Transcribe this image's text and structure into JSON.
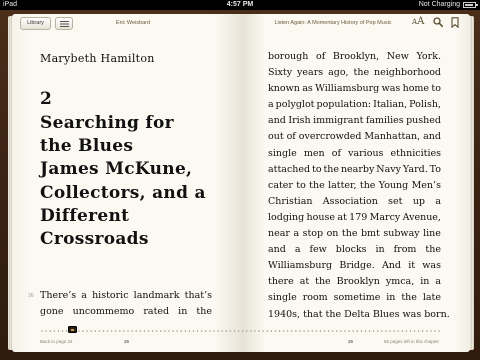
{
  "status_bar": {
    "device": "iPad",
    "time": "4:57 PM",
    "charging": "Not Charging"
  },
  "toolbar": {
    "library_label": "Library",
    "author": "Eric Weisbard",
    "book_title": "Listen Again: A Momentary History of Pop Music",
    "icons": [
      "table-of-contents-icon",
      "font-size-icon",
      "search-icon",
      "bookmark-icon"
    ]
  },
  "left_page": {
    "author_name": "Marybeth Hamilton",
    "chapter_number": "2",
    "chapter_title_lines": [
      "Searching for",
      "the Blues",
      "James McKune,",
      "Collectors, and a",
      "Different",
      "Crossroads"
    ],
    "margin_page": "26",
    "body_lines": [
      [
        "There’s",
        "a",
        "historic",
        "landmark",
        "that’s"
      ],
      [
        "gone",
        "uncommemo",
        "rated",
        "in",
        "the"
      ]
    ]
  },
  "right_page": {
    "body_lines": [
      [
        "borough",
        "of",
        "Brooklyn,",
        "New",
        "York."
      ],
      [
        "Sixty",
        "years",
        "ago,",
        "the",
        "neighborhood"
      ],
      [
        "known",
        "as",
        "Williamsburg",
        "was",
        "home",
        "to"
      ],
      [
        "a",
        "polyglot",
        "population:",
        "Italian,",
        "Polish,"
      ],
      [
        "and",
        "Irish",
        "immigrant",
        "families",
        "pushed"
      ],
      [
        "out",
        "of",
        "overcrowded",
        "Manhattan,",
        "and"
      ],
      [
        "single",
        "men",
        "of",
        "various",
        "ethnicities"
      ],
      [
        "attached",
        "to",
        "the",
        "nearby",
        "Navy",
        "Yard.",
        "To"
      ],
      [
        "cater",
        "to",
        "the",
        "latter,",
        "the",
        "Young",
        "Men’s"
      ],
      [
        "Christian",
        "Association",
        "set",
        "up",
        "a"
      ],
      [
        "lodging",
        "house",
        "at",
        "179",
        "Marcy",
        "Avenue,"
      ],
      [
        "near",
        "a",
        "stop",
        "on",
        "the",
        "bmt",
        "subway",
        "line"
      ],
      [
        "and",
        "a",
        "few",
        "blocks",
        "in",
        "from",
        "the"
      ],
      [
        "Williamsburg",
        "Bridge.",
        "And",
        "it",
        "was"
      ],
      [
        "there",
        "at",
        "the",
        "Brooklyn",
        "ymca,",
        "in",
        "a"
      ],
      [
        "single",
        "room",
        "sometime",
        "in",
        "the",
        "late"
      ],
      [
        "1940s, that the Delta Blues was born."
      ]
    ]
  },
  "footer": {
    "back_link": "Back to page 24",
    "left_page_number": "26",
    "right_page_number": "26",
    "pages_left": "65 pages left in this chapter",
    "reading_progress": 0.07
  }
}
